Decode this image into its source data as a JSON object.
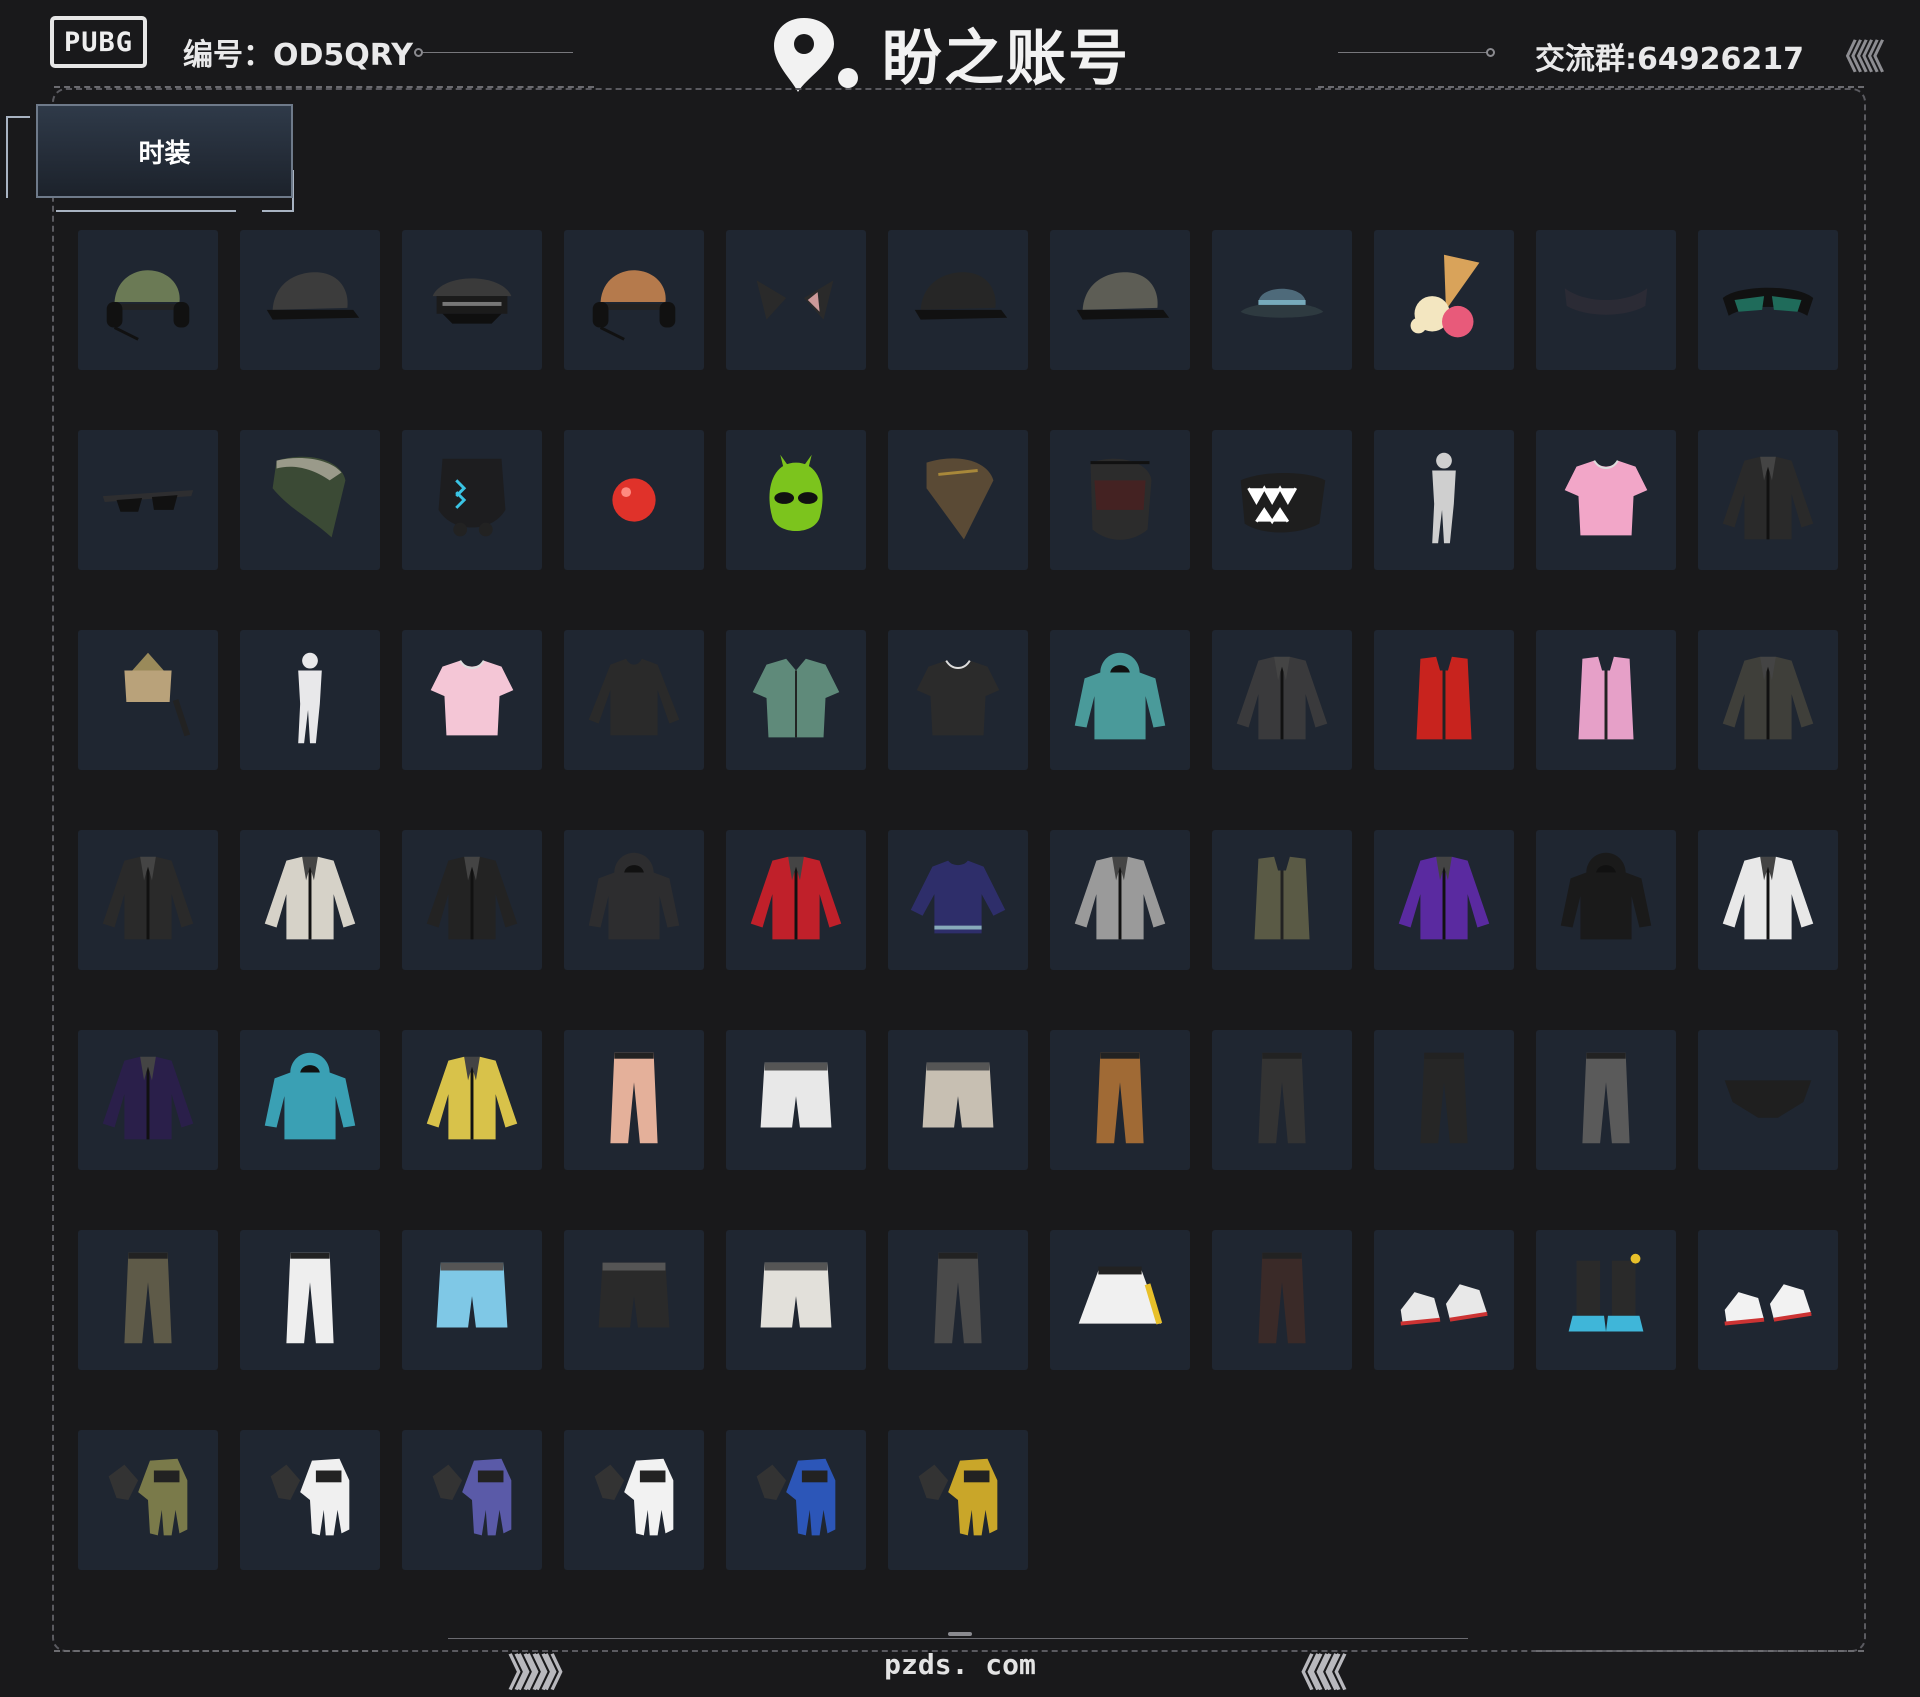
{
  "header": {
    "logo_text": "PUBG",
    "id_label": "编号：OD5QRY",
    "brand_name": "盼之账号",
    "group_label": "交流群:64926217",
    "chevrons_right": "《《《"
  },
  "tabs": [
    {
      "label": "时装"
    }
  ],
  "items": [
    {
      "icon": "headset-cap"
    },
    {
      "icon": "cap"
    },
    {
      "icon": "officer-cap"
    },
    {
      "icon": "headset-cap"
    },
    {
      "icon": "cat-ears"
    },
    {
      "icon": "cap"
    },
    {
      "icon": "cap"
    },
    {
      "icon": "bucket-hat"
    },
    {
      "icon": "ice-cream-hat"
    },
    {
      "icon": "visor"
    },
    {
      "icon": "goggles"
    },
    {
      "icon": "sunglasses"
    },
    {
      "icon": "bandana"
    },
    {
      "icon": "tactical-mask"
    },
    {
      "icon": "clown-nose"
    },
    {
      "icon": "alien-mask"
    },
    {
      "icon": "scarf-mask"
    },
    {
      "icon": "face-mask"
    },
    {
      "icon": "teeth-mask"
    },
    {
      "icon": "bodysuit"
    },
    {
      "icon": "t-shirt"
    },
    {
      "icon": "jacket"
    },
    {
      "icon": "crop-top"
    },
    {
      "icon": "bodysuit"
    },
    {
      "icon": "t-shirt"
    },
    {
      "icon": "long-sleeve"
    },
    {
      "icon": "shirt"
    },
    {
      "icon": "t-shirt"
    },
    {
      "icon": "hoodie"
    },
    {
      "icon": "jacket"
    },
    {
      "icon": "vest"
    },
    {
      "icon": "vest"
    },
    {
      "icon": "jacket"
    },
    {
      "icon": "jacket"
    },
    {
      "icon": "jacket"
    },
    {
      "icon": "jacket"
    },
    {
      "icon": "hoodie"
    },
    {
      "icon": "jacket"
    },
    {
      "icon": "sweatshirt"
    },
    {
      "icon": "jacket"
    },
    {
      "icon": "vest"
    },
    {
      "icon": "jacket"
    },
    {
      "icon": "hoodie"
    },
    {
      "icon": "jacket"
    },
    {
      "icon": "jacket"
    },
    {
      "icon": "hoodie"
    },
    {
      "icon": "jacket"
    },
    {
      "icon": "pants"
    },
    {
      "icon": "shorts"
    },
    {
      "icon": "shorts"
    },
    {
      "icon": "pants"
    },
    {
      "icon": "pants"
    },
    {
      "icon": "pants"
    },
    {
      "icon": "pants"
    },
    {
      "icon": "briefs"
    },
    {
      "icon": "pants"
    },
    {
      "icon": "pants"
    },
    {
      "icon": "shorts"
    },
    {
      "icon": "shorts"
    },
    {
      "icon": "shorts"
    },
    {
      "icon": "pants"
    },
    {
      "icon": "skirt"
    },
    {
      "icon": "pants"
    },
    {
      "icon": "sneakers"
    },
    {
      "icon": "boots"
    },
    {
      "icon": "sneakers"
    },
    {
      "icon": "gloves"
    },
    {
      "icon": "gloves"
    },
    {
      "icon": "gloves"
    },
    {
      "icon": "gloves"
    },
    {
      "icon": "gloves"
    },
    {
      "icon": "gloves"
    }
  ],
  "palette": [
    "#6b7a55",
    "#3c3c3c",
    "#3a3a3a",
    "#b57a4c",
    "#2a2a2a",
    "#262626",
    "#5d5d55",
    "#4e6a7a",
    "#d9a35a",
    "#2b2b35",
    "#1f6b5a",
    "#2e2e30",
    "#3b4a35",
    "#1d1d1f",
    "#e0322a",
    "#7cc41d",
    "#5a4a35",
    "#2c2c2c",
    "#1e1e1e",
    "#cfcfcf",
    "#f2a6c8",
    "#2a2a2a",
    "#b9a27a",
    "#e8e8ea",
    "#f4c6d6",
    "#2a2a2a",
    "#5f8a7a",
    "#2b2b2b",
    "#4a9a9a",
    "#3a3a3c",
    "#c8231e",
    "#e6a0c8",
    "#3f3f3a",
    "#2a2a2a",
    "#d6d2c8",
    "#232323",
    "#2d2d2f",
    "#c0202a",
    "#2e2e6a",
    "#9a9a9a",
    "#5a5a45",
    "#5a2aa0",
    "#1a1a1a",
    "#e8e8e8",
    "#2a1f4a",
    "#3aa0b4",
    "#d8c24a",
    "#e4b09a",
    "#e8e8e8",
    "#c7bfb2",
    "#a06a35",
    "#333333",
    "#262626",
    "#5a5a5a",
    "#1f1f1f",
    "#5e5a48",
    "#eeeeee",
    "#7fc8e6",
    "#2a2a2a",
    "#e2e0da",
    "#4a4a4a",
    "#f0f0f0",
    "#3a2a28",
    "#e8e8e8",
    "#3fb6d9",
    "#f2f2f2",
    "#7a7a4a",
    "#f0f0f0",
    "#5a5aa8",
    "#f2f2f2",
    "#2c56b8",
    "#c9a629"
  ],
  "footer": {
    "site": "pzds. com",
    "chev_left": "》》》》》",
    "chev_right": "《《《《"
  }
}
